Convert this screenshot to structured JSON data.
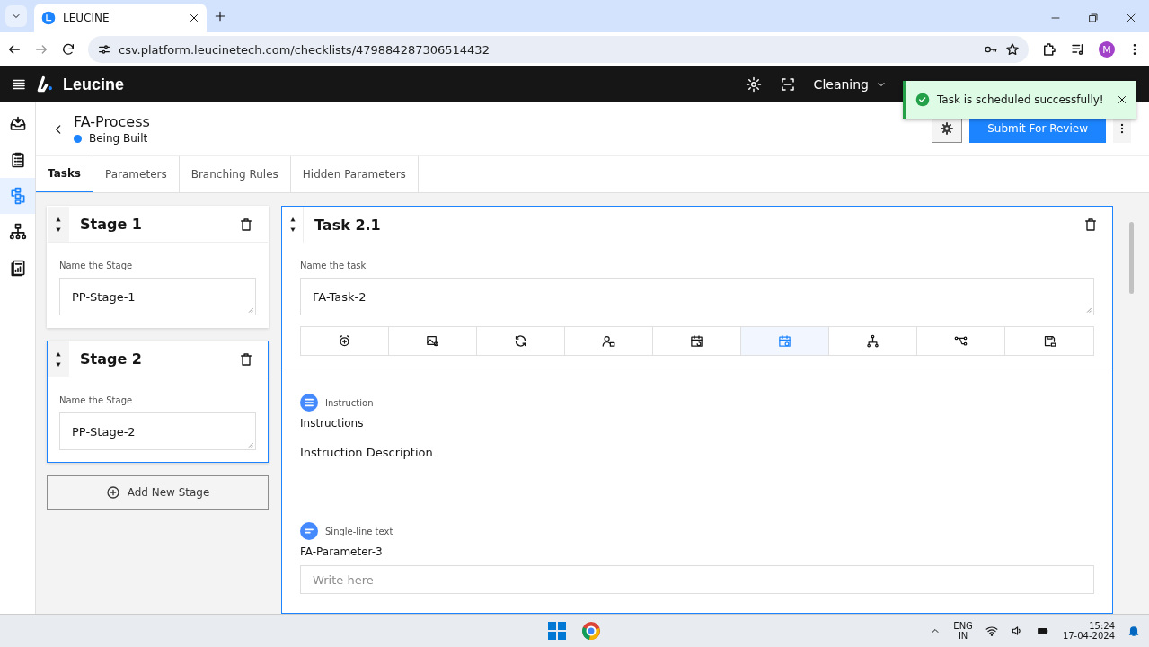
{
  "browser": {
    "tab_title": "LEUCINE",
    "url": "csv.platform.leucinetech.com/checklists/479884287306514432",
    "profile": "M"
  },
  "app_header": {
    "brand": "Leucine",
    "facility": "Cleaning"
  },
  "toast": {
    "message": "Task is scheduled successfully!"
  },
  "sidebar": {
    "items": [
      {
        "kind": "inbox",
        "selected": false
      },
      {
        "kind": "checklist",
        "selected": false
      },
      {
        "kind": "flow",
        "selected": true
      },
      {
        "kind": "hierarchy",
        "selected": false
      },
      {
        "kind": "report",
        "selected": false
      }
    ]
  },
  "checklist": {
    "title": "FA-Process",
    "status": "Being Built",
    "submit_button": "Submit For Review"
  },
  "tabs": [
    {
      "label": "Tasks",
      "selected": true
    },
    {
      "label": "Parameters",
      "selected": false
    },
    {
      "label": "Branching Rules",
      "selected": false
    },
    {
      "label": "Hidden Parameters",
      "selected": false
    }
  ],
  "stages": [
    {
      "title": "Stage 1",
      "label": "Name the Stage",
      "value": "PP-Stage-1",
      "selected": false
    },
    {
      "title": "Stage 2",
      "label": "Name the Stage",
      "value": "PP-Stage-2",
      "selected": true
    }
  ],
  "add_stage_button": "Add New Stage",
  "task": {
    "title": "Task 2.1",
    "name_label": "Name the task",
    "name_value": "FA-Task-2",
    "toolbar": [
      {
        "kind": "alarm",
        "selected": false
      },
      {
        "kind": "image",
        "selected": false
      },
      {
        "kind": "recurrence",
        "selected": false
      },
      {
        "kind": "user-lock",
        "selected": false
      },
      {
        "kind": "calendar-repeat",
        "selected": false
      },
      {
        "kind": "calendar-clock",
        "selected": true
      },
      {
        "kind": "branch",
        "selected": false
      },
      {
        "kind": "connect",
        "selected": false
      },
      {
        "kind": "save-lock",
        "selected": false
      }
    ],
    "parameters": [
      {
        "kind": "instruction",
        "type_label": "Instruction",
        "title": "Instructions",
        "description": "Instruction Description"
      },
      {
        "kind": "single_line",
        "type_label": "Single-line text",
        "title": "FA-Parameter-3",
        "placeholder": "Write here"
      }
    ]
  },
  "taskbar": {
    "language": "ENG",
    "region": "IN",
    "time": "15:24",
    "date": "17-04-2024"
  }
}
